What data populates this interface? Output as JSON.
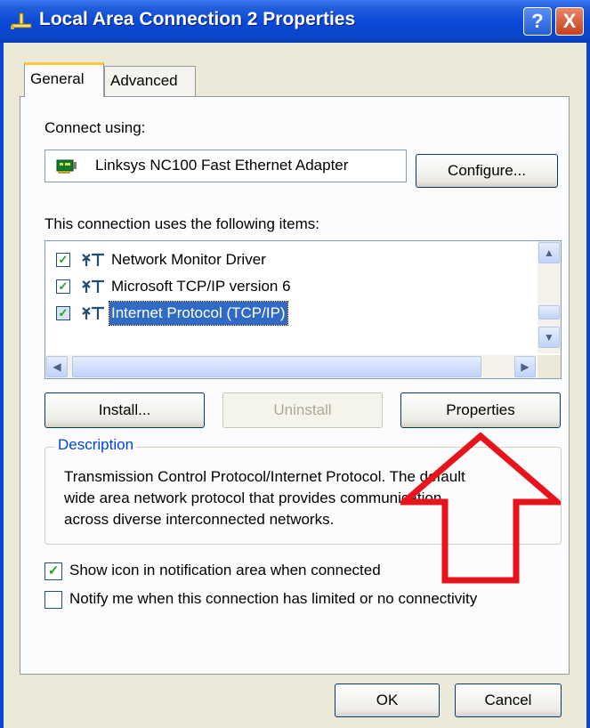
{
  "window": {
    "title": "Local Area Connection 2 Properties",
    "help_glyph": "?",
    "close_glyph": "X"
  },
  "tabs": [
    {
      "label": "General",
      "active": true
    },
    {
      "label": "Advanced",
      "active": false
    }
  ],
  "connect_using": {
    "label": "Connect using:",
    "adapter": "Linksys NC100 Fast Ethernet Adapter",
    "configure_button": "Configure..."
  },
  "items_section": {
    "label": "This connection uses the following items:",
    "items": [
      {
        "label": "Network Monitor Driver",
        "checked": true,
        "selected": false
      },
      {
        "label": "Microsoft TCP/IP version 6",
        "checked": true,
        "selected": false
      },
      {
        "label": "Internet Protocol (TCP/IP)",
        "checked": true,
        "selected": true
      }
    ]
  },
  "buttons": {
    "install": "Install...",
    "uninstall": "Uninstall",
    "properties": "Properties",
    "ok": "OK",
    "cancel": "Cancel"
  },
  "description": {
    "legend": "Description",
    "line1": "Transmission Control Protocol/Internet Protocol. The default",
    "line2": "wide area network protocol that provides communication",
    "line3": "across diverse interconnected networks."
  },
  "options": {
    "show_icon": {
      "label": "Show icon in notification area when connected",
      "checked": true
    },
    "notify": {
      "label": "Notify me when this connection has limited or no connectivity",
      "checked": false
    }
  },
  "annotation": {
    "color": "#E8141B",
    "shape": "arrow-up-icon"
  }
}
